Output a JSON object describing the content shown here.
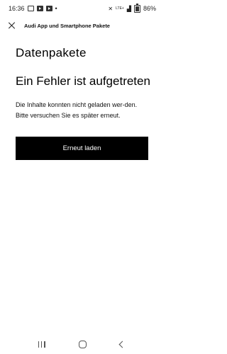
{
  "status_bar": {
    "time": "16:36",
    "battery_percent": "86%",
    "signal_text": "LTE+"
  },
  "header": {
    "title": "Audi App und Smartphone Pakete"
  },
  "main": {
    "page_title": "Datenpakete",
    "error_heading": "Ein Fehler ist aufgetreten",
    "error_message": "Die Inhalte konnten nicht geladen wer-den. Bitte versuchen Sie es später erneut.",
    "retry_button_label": "Erneut laden"
  },
  "colors": {
    "background": "#ffffff",
    "button_background": "#000000",
    "button_text": "#ffffff"
  },
  "icons": {
    "close": "close-icon",
    "recents": "recents-icon",
    "home": "home-icon",
    "back": "back-icon"
  }
}
